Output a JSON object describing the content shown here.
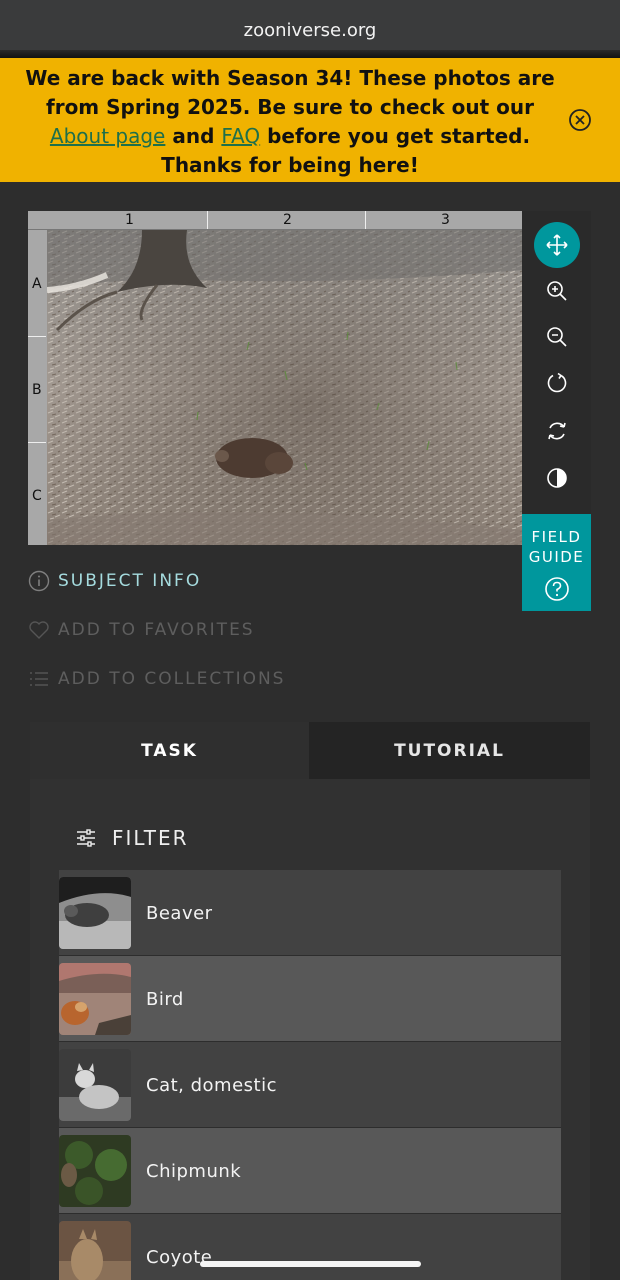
{
  "browser": {
    "url": "zooniverse.org"
  },
  "banner": {
    "text_1": "We are back with Season 34! These photos are from Spring 2025. Be sure to check out our",
    "link_about": "About page",
    "text_and": "and",
    "link_faq": "FAQ",
    "text_2": "before you get started. Thanks for being here!",
    "close_icon": "close-circle-icon"
  },
  "viewer": {
    "grid_columns": [
      "1",
      "2",
      "3"
    ],
    "grid_rows": [
      "A",
      "B",
      "C"
    ]
  },
  "toolbar": {
    "tools": [
      "move-icon",
      "zoom-in-icon",
      "zoom-out-icon",
      "rotate-icon",
      "reset-icon",
      "invert-icon"
    ],
    "field_guide_line1": "FIELD",
    "field_guide_line2": "GUIDE"
  },
  "meta": {
    "subject_info": "SUBJECT INFO",
    "add_favorites": "ADD TO FAVORITES",
    "add_collections": "ADD TO COLLECTIONS"
  },
  "tabs": {
    "task": "TASK",
    "tutorial": "TUTORIAL"
  },
  "filter": {
    "label": "FILTER"
  },
  "choices": [
    {
      "label": "Beaver"
    },
    {
      "label": "Bird"
    },
    {
      "label": "Cat, domestic"
    },
    {
      "label": "Chipmunk"
    },
    {
      "label": "Coyote"
    }
  ],
  "colors": {
    "accent": "#00979d",
    "banner": "#f0b200",
    "link": "#1f6f4a"
  }
}
